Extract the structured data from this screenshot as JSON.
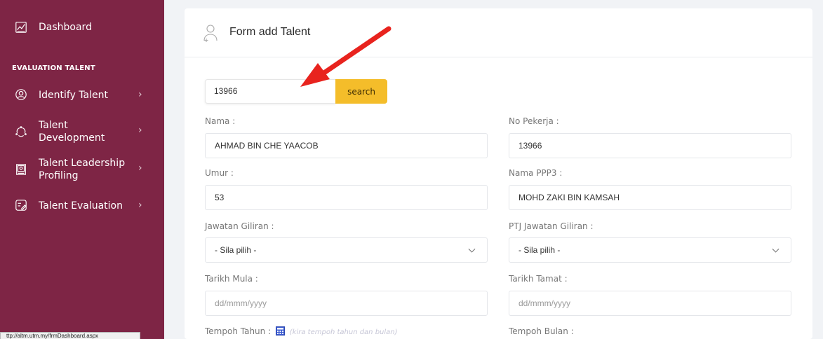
{
  "sidebar": {
    "dashboard_label": "Dashboard",
    "section_title": "EVALUATION TALENT",
    "items": [
      {
        "label": "Identify Talent",
        "icon": "user-circle-icon"
      },
      {
        "label_line1": "Talent",
        "label_line2": "Development",
        "icon": "cycle-icon"
      },
      {
        "label_line1": "Talent Leadership",
        "label_line2": "Profiling",
        "icon": "presentation-board-icon"
      },
      {
        "label": "Talent Evaluation",
        "icon": "checklist-icon"
      }
    ],
    "chevron": "›",
    "background_color": "#7e2545"
  },
  "form": {
    "title": "Form add Talent",
    "search_value": "13966",
    "search_button": "search",
    "nama_label": "Nama :",
    "nama_value": "AHMAD BIN CHE YAACOB",
    "no_pekerja_label": "No Pekerja :",
    "no_pekerja_value": "13966",
    "umur_label": "Umur :",
    "umur_value": "53",
    "nama_ppp3_label": "Nama PPP3 :",
    "nama_ppp3_value": "MOHD ZAKI BIN KAMSAH",
    "jawatan_label": "Jawatan Giliran :",
    "jawatan_selected": "- Sila pilih -",
    "ptj_label": "PTJ Jawatan Giliran :",
    "ptj_selected": "- Sila pilih -",
    "tarikh_mula_label": "Tarikh Mula :",
    "tarikh_mula_placeholder": "dd/mmm/yyyy",
    "tarikh_tamat_label": "Tarikh Tamat :",
    "tarikh_tamat_placeholder": "dd/mmm/yyyy",
    "tempoh_tahun_label": "Tempoh Tahun :",
    "tempoh_hint": "(kira tempoh tahun dan bulan)",
    "tempoh_bulan_label": "Tempoh Bulan :",
    "accent_color": "#f4bd2a"
  },
  "status_bar": {
    "url": "ttp://altm.utm.my/frmDashboard.aspx"
  },
  "annotation": {
    "arrow_color": "#e8231e"
  }
}
